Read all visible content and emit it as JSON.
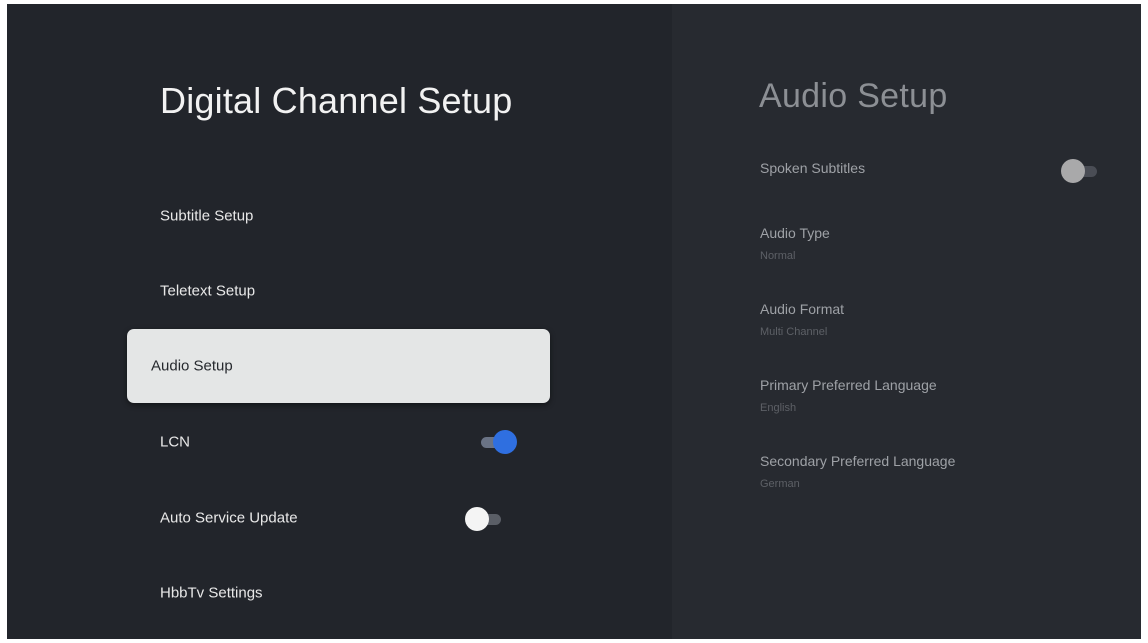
{
  "left_panel": {
    "title": "Digital Channel Setup",
    "items": [
      {
        "label": "Subtitle Setup"
      },
      {
        "label": "Teletext Setup"
      },
      {
        "label": "Audio Setup",
        "selected": true
      },
      {
        "label": "LCN",
        "toggle": "on"
      },
      {
        "label": "Auto Service Update",
        "toggle": "off"
      },
      {
        "label": "HbbTv Settings"
      }
    ]
  },
  "right_panel": {
    "title": "Audio Setup",
    "items": [
      {
        "label": "Spoken Subtitles",
        "toggle": "off"
      },
      {
        "label": "Audio Type",
        "value": "Normal"
      },
      {
        "label": "Audio Format",
        "value": "Multi Channel"
      },
      {
        "label": "Primary Preferred Language",
        "value": "English"
      },
      {
        "label": "Secondary Preferred Language",
        "value": "German"
      }
    ]
  },
  "colors": {
    "background": "#22252b",
    "right_panel_bg": "#272a30",
    "selected_bg": "#e4e6e6",
    "toggle_on": "#2f6fe0"
  }
}
